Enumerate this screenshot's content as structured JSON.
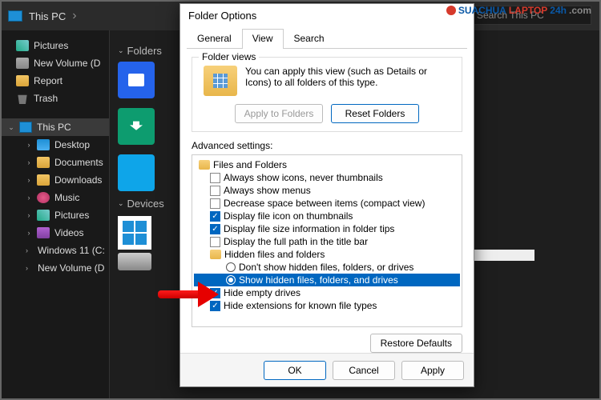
{
  "explorer": {
    "address": "This PC",
    "search_placeholder": "Search This PC",
    "sidebar": [
      {
        "icon": "pic",
        "label": "Pictures",
        "chev": ""
      },
      {
        "icon": "drive",
        "label": "New Volume (D",
        "chev": ""
      },
      {
        "icon": "folder",
        "label": "Report",
        "chev": ""
      },
      {
        "icon": "trash",
        "label": "Trash",
        "chev": ""
      },
      {
        "icon": "pc",
        "label": "This PC",
        "chev": "v",
        "selected": true,
        "top": true
      },
      {
        "icon": "desk",
        "label": "Desktop",
        "chev": ">",
        "nested": true
      },
      {
        "icon": "folder",
        "label": "Documents",
        "chev": ">",
        "nested": true
      },
      {
        "icon": "folder",
        "label": "Downloads",
        "chev": ">",
        "nested": true
      },
      {
        "icon": "music",
        "label": "Music",
        "chev": ">",
        "nested": true
      },
      {
        "icon": "pic",
        "label": "Pictures",
        "chev": ">",
        "nested": true
      },
      {
        "icon": "video",
        "label": "Videos",
        "chev": ">",
        "nested": true
      },
      {
        "icon": "win",
        "label": "Windows 11 (C:",
        "chev": ">",
        "nested": true
      },
      {
        "icon": "drive",
        "label": "New Volume (D",
        "chev": ">",
        "nested": true
      }
    ],
    "sections": {
      "folders": "Folders",
      "devices": "Devices"
    }
  },
  "dialog": {
    "title": "Folder Options",
    "tabs": {
      "general": "General",
      "view": "View",
      "search": "Search",
      "active": "view"
    },
    "folder_views": {
      "legend": "Folder views",
      "text": "You can apply this view (such as Details or Icons) to all folders of this type.",
      "apply_btn": "Apply to Folders",
      "reset_btn": "Reset Folders"
    },
    "advanced": {
      "label": "Advanced settings:",
      "items": [
        {
          "type": "folder",
          "level": 0,
          "label": "Files and Folders"
        },
        {
          "type": "check",
          "level": 1,
          "checked": false,
          "label": "Always show icons, never thumbnails"
        },
        {
          "type": "check",
          "level": 1,
          "checked": false,
          "label": "Always show menus"
        },
        {
          "type": "check",
          "level": 1,
          "checked": false,
          "label": "Decrease space between items (compact view)"
        },
        {
          "type": "check",
          "level": 1,
          "checked": true,
          "label": "Display file icon on thumbnails"
        },
        {
          "type": "check",
          "level": 1,
          "checked": true,
          "label": "Display file size information in folder tips"
        },
        {
          "type": "check",
          "level": 1,
          "checked": false,
          "label": "Display the full path in the title bar"
        },
        {
          "type": "folder",
          "level": 1,
          "label": "Hidden files and folders"
        },
        {
          "type": "radio",
          "level": 2,
          "checked": false,
          "label": "Don't show hidden files, folders, or drives"
        },
        {
          "type": "radio",
          "level": 2,
          "checked": true,
          "selected": true,
          "label": "Show hidden files, folders, and drives"
        },
        {
          "type": "check",
          "level": 1,
          "checked": true,
          "label": "Hide empty drives"
        },
        {
          "type": "check",
          "level": 1,
          "checked": true,
          "label": "Hide extensions for known file types"
        }
      ],
      "restore_btn": "Restore Defaults"
    },
    "footer": {
      "ok": "OK",
      "cancel": "Cancel",
      "apply": "Apply"
    }
  },
  "branding": {
    "prefix": "SUACHUA",
    "mid": "LAPTOP",
    "suffix": "24h",
    "tld": ".com"
  }
}
